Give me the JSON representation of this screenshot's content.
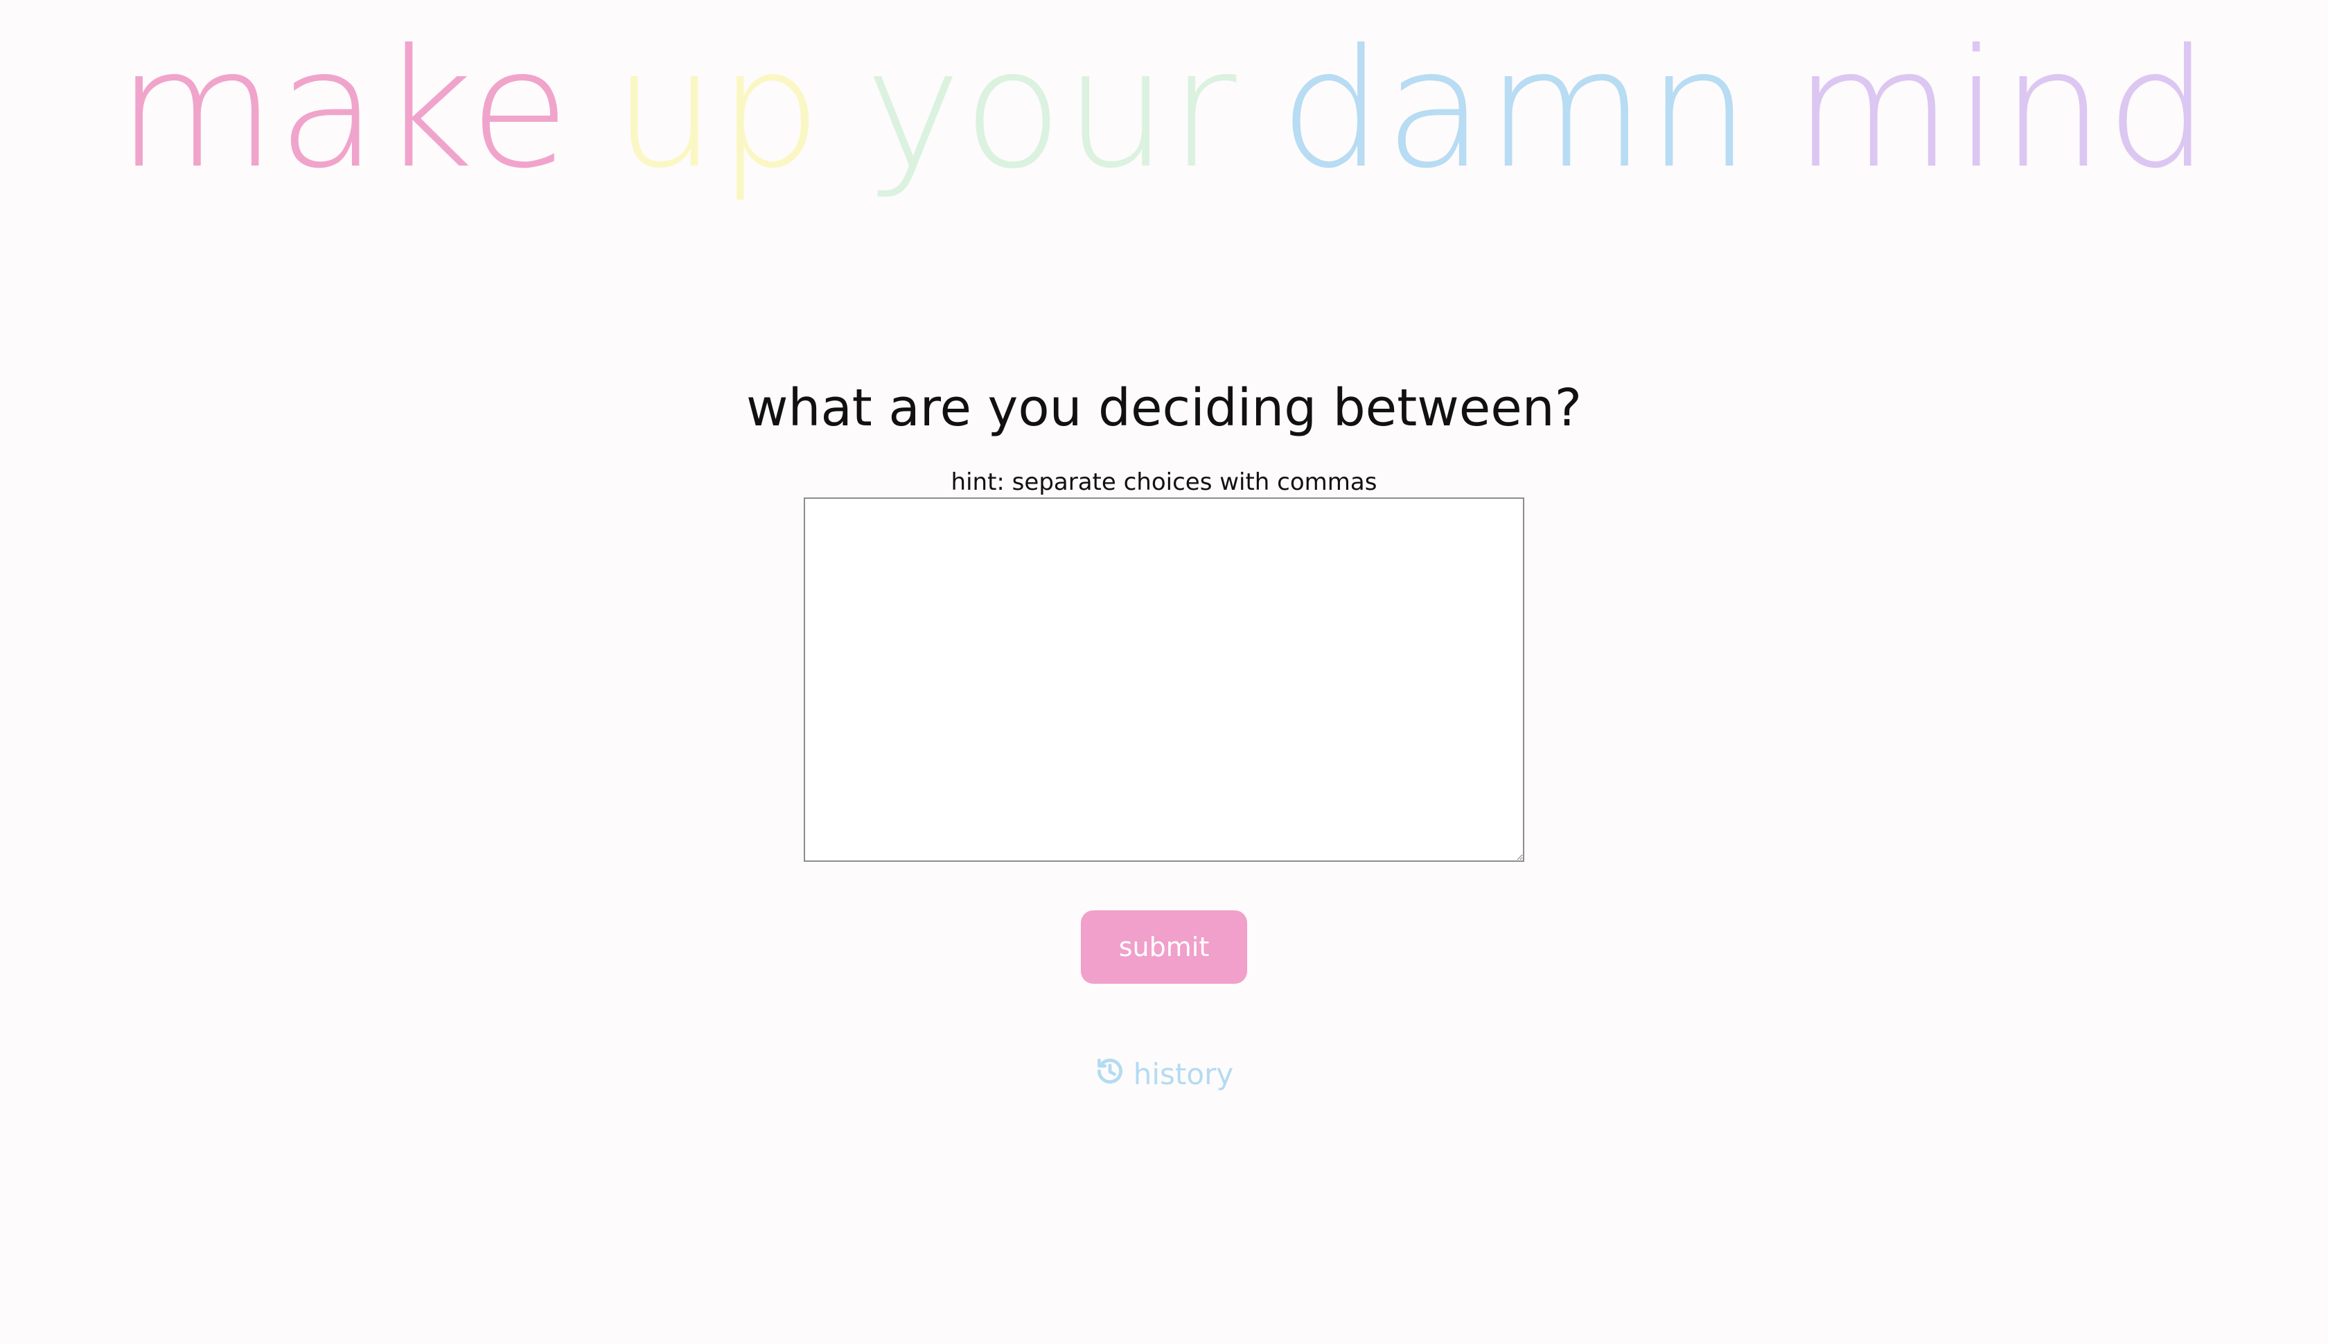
{
  "title": {
    "words": [
      {
        "text": "make",
        "color": "#f0a4cb"
      },
      {
        "text": "up",
        "color": "#fbf7c4"
      },
      {
        "text": "your",
        "color": "#daf2df"
      },
      {
        "text": "damn",
        "color": "#b7dcf3"
      },
      {
        "text": "mind",
        "color": "#dcc6f2"
      }
    ]
  },
  "question": "what are you deciding between?",
  "hint": "hint: separate choices with commas",
  "choices_input": {
    "value": "",
    "placeholder": ""
  },
  "submit": {
    "label": "submit",
    "color": "#f0a0ca"
  },
  "history": {
    "label": "history",
    "icon": "history-icon",
    "color": "#b3dbf2"
  }
}
